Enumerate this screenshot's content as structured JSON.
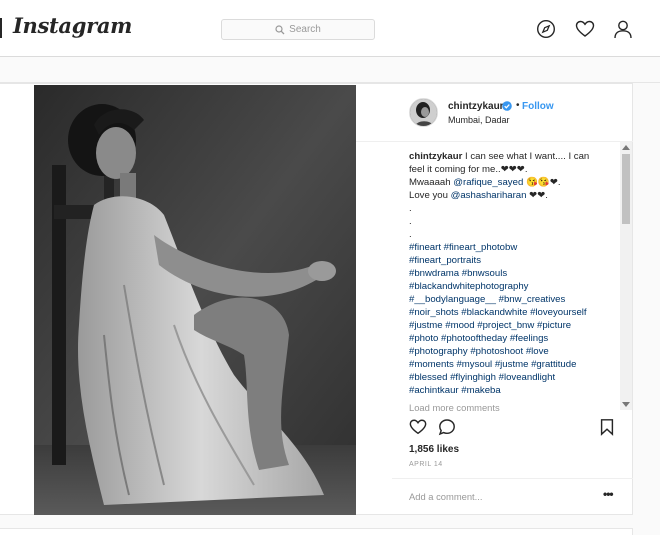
{
  "header": {
    "logo": "Instagram",
    "search_placeholder": "Search",
    "icons": [
      "compass-icon",
      "heart-icon",
      "profile-icon"
    ]
  },
  "post": {
    "username": "chintzykaur",
    "verified": true,
    "follow_label": "Follow",
    "dot": "•",
    "location": "Mumbai, Dadar",
    "comment_lines": [
      [
        {
          "t": "chintzykaur",
          "k": "uname"
        },
        {
          "t": " I can see what I want.... I can",
          "k": "text"
        }
      ],
      [
        {
          "t": "feel it coming for me..❤❤❤.",
          "k": "text"
        }
      ],
      [
        {
          "t": "Mwaaaah ",
          "k": "text"
        },
        {
          "t": "@rafique_sayed",
          "k": "tag"
        },
        {
          "t": " 😘😘❤.",
          "k": "text"
        }
      ],
      [
        {
          "t": "Love you ",
          "k": "text"
        },
        {
          "t": "@ashashariharan",
          "k": "tag"
        },
        {
          "t": " ❤❤.",
          "k": "text"
        }
      ],
      [
        {
          "t": ".",
          "k": "text"
        }
      ],
      [
        {
          "t": ".",
          "k": "text"
        }
      ],
      [
        {
          "t": ".",
          "k": "text"
        }
      ],
      [
        {
          "t": "#fineart #fineart_photobw",
          "k": "tag"
        }
      ],
      [
        {
          "t": "#fineart_portraits",
          "k": "tag"
        }
      ],
      [
        {
          "t": "#bnwdrama #bnwsouls",
          "k": "tag"
        }
      ],
      [
        {
          "t": "#blackandwhitephotography",
          "k": "tag"
        }
      ],
      [
        {
          "t": "#__bodylanguage__ #bnw_creatives",
          "k": "tag"
        }
      ],
      [
        {
          "t": "#noir_shots #blackandwhite #loveyourself",
          "k": "tag"
        }
      ],
      [
        {
          "t": "#justme #mood #project_bnw #picture",
          "k": "tag"
        }
      ],
      [
        {
          "t": "#photo #photooftheday #feelings",
          "k": "tag"
        }
      ],
      [
        {
          "t": "#photography #photoshoot #love",
          "k": "tag"
        }
      ],
      [
        {
          "t": "#moments #mysoul #justme #grattitude",
          "k": "tag"
        }
      ],
      [
        {
          "t": "#blessed #flyinghigh #loveandlight",
          "k": "tag"
        }
      ],
      [
        {
          "t": "#achintkaur #makeba",
          "k": "tag"
        }
      ]
    ],
    "load_more": "Load more comments",
    "likes": "1,856 likes",
    "date": "APRIL 14",
    "add_comment_placeholder": "Add a comment...",
    "more_label": "•••",
    "colors": {
      "tag": "#003569",
      "follow": "#3897f0",
      "verified": "#3897f0"
    }
  }
}
